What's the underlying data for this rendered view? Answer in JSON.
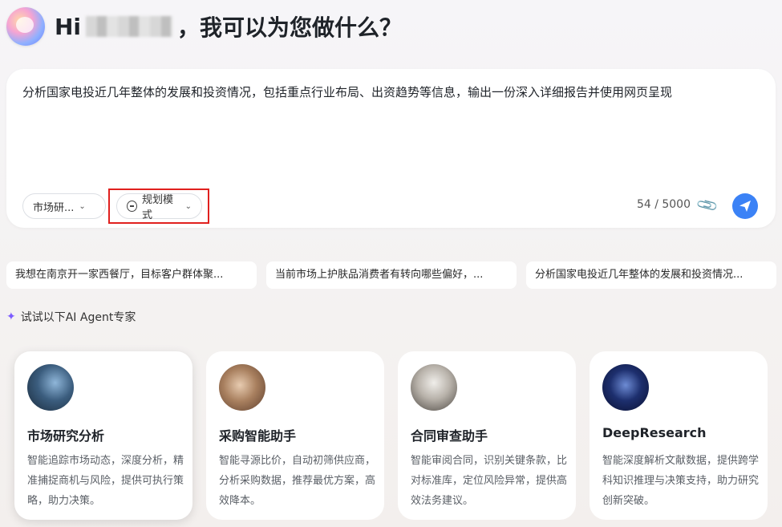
{
  "greeting": {
    "prefix": "Hi",
    "suffix": "，我可以为您做什么？"
  },
  "input": {
    "text": "分析国家电投近几年整体的发展和投资情况，包括重点行业布局、出资趋势等信息，输出一份深入详细报告并使用网页呈现",
    "market_chip": "市场研...",
    "mode_chip": "规划模式",
    "counter": "54 / 5000"
  },
  "suggestions": [
    "我想在南京开一家西餐厅，目标客户群体聚...",
    "当前市场上护肤品消费者有转向哪些偏好，...",
    "分析国家电投近几年整体的发展和投资情况..."
  ],
  "agents_label": "试试以下AI Agent专家",
  "agents": [
    {
      "title": "市场研究分析",
      "desc": "智能追踪市场动态，深度分析，精准捕捉商机与风险，提供可执行策略，助力决策。"
    },
    {
      "title": "采购智能助手",
      "desc": "智能寻源比价，自动初筛供应商，分析采购数据，推荐最优方案，高效降本。"
    },
    {
      "title": "合同审查助手",
      "desc": "智能审阅合同，识别关键条款，比对标准库，定位风险异常，提供高效法务建议。"
    },
    {
      "title": "DeepResearch",
      "desc": "智能深度解析文献数据，提供跨学科知识推理与决策支持，助力研究创新突破。"
    }
  ],
  "colors": {
    "accent": "#3b82f6",
    "highlight_box": "#e0201e"
  }
}
